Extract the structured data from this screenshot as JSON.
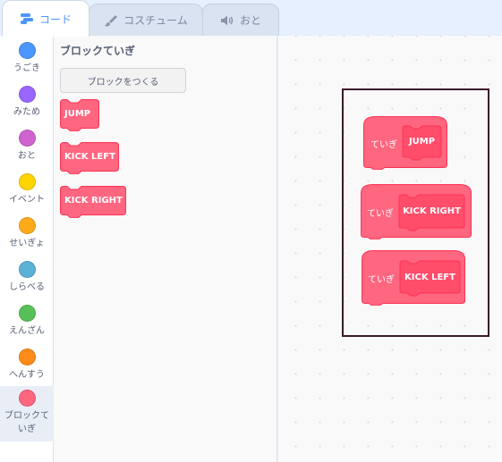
{
  "tabs": [
    {
      "label": "コード",
      "icon": "code-icon"
    },
    {
      "label": "コスチューム",
      "icon": "brush-icon"
    },
    {
      "label": "おと",
      "icon": "speaker-icon"
    }
  ],
  "categories": [
    {
      "label": "うごき",
      "color": "#4c97ff"
    },
    {
      "label": "みため",
      "color": "#9966ff"
    },
    {
      "label": "おと",
      "color": "#cf63cf"
    },
    {
      "label": "イベント",
      "color": "#ffd500"
    },
    {
      "label": "せいぎょ",
      "color": "#ffab19"
    },
    {
      "label": "しらべる",
      "color": "#5cb1d6"
    },
    {
      "label": "えんざん",
      "color": "#59c059"
    },
    {
      "label": "へんすう",
      "color": "#ff8c1a"
    },
    {
      "label": "ブロックていぎ",
      "color": "#ff6680"
    }
  ],
  "palette": {
    "title": "ブロックていぎ",
    "make_block_label": "ブロックをつくる",
    "blocks": [
      "JUMP",
      "KICK LEFT",
      "KICK RIGHT"
    ]
  },
  "script": {
    "definitions": [
      {
        "define_label": "ていぎ",
        "name": "JUMP"
      },
      {
        "define_label": "ていぎ",
        "name": "KICK RIGHT"
      },
      {
        "define_label": "ていぎ",
        "name": "KICK LEFT"
      }
    ]
  },
  "colors": {
    "custom_block": "#ff6680",
    "custom_block_dark": "#ff4d6a",
    "custom_block_border": "#ff3355",
    "accent": "#4c97ff"
  }
}
